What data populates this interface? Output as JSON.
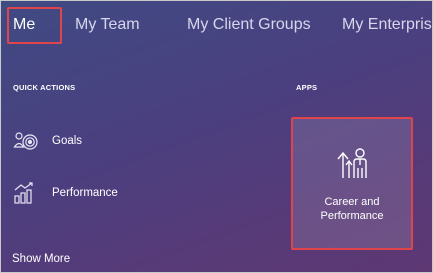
{
  "nav": {
    "tabs": [
      {
        "label": "Me",
        "active": true
      },
      {
        "label": "My Team",
        "active": false
      },
      {
        "label": "My Client Groups",
        "active": false
      },
      {
        "label": "My Enterprise",
        "active": false
      }
    ]
  },
  "quick_actions": {
    "heading": "QUICK ACTIONS",
    "items": [
      {
        "label": "Goals",
        "icon": "goals-icon"
      },
      {
        "label": "Performance",
        "icon": "performance-icon"
      }
    ],
    "show_more": "Show More"
  },
  "apps": {
    "heading": "APPS",
    "tiles": [
      {
        "label_line1": "Career and",
        "label_line2": "Performance",
        "icon": "career-performance-icon"
      }
    ]
  },
  "colors": {
    "highlight": "#e0454b",
    "background_start": "#3f4a83",
    "background_end": "#5d3873"
  }
}
